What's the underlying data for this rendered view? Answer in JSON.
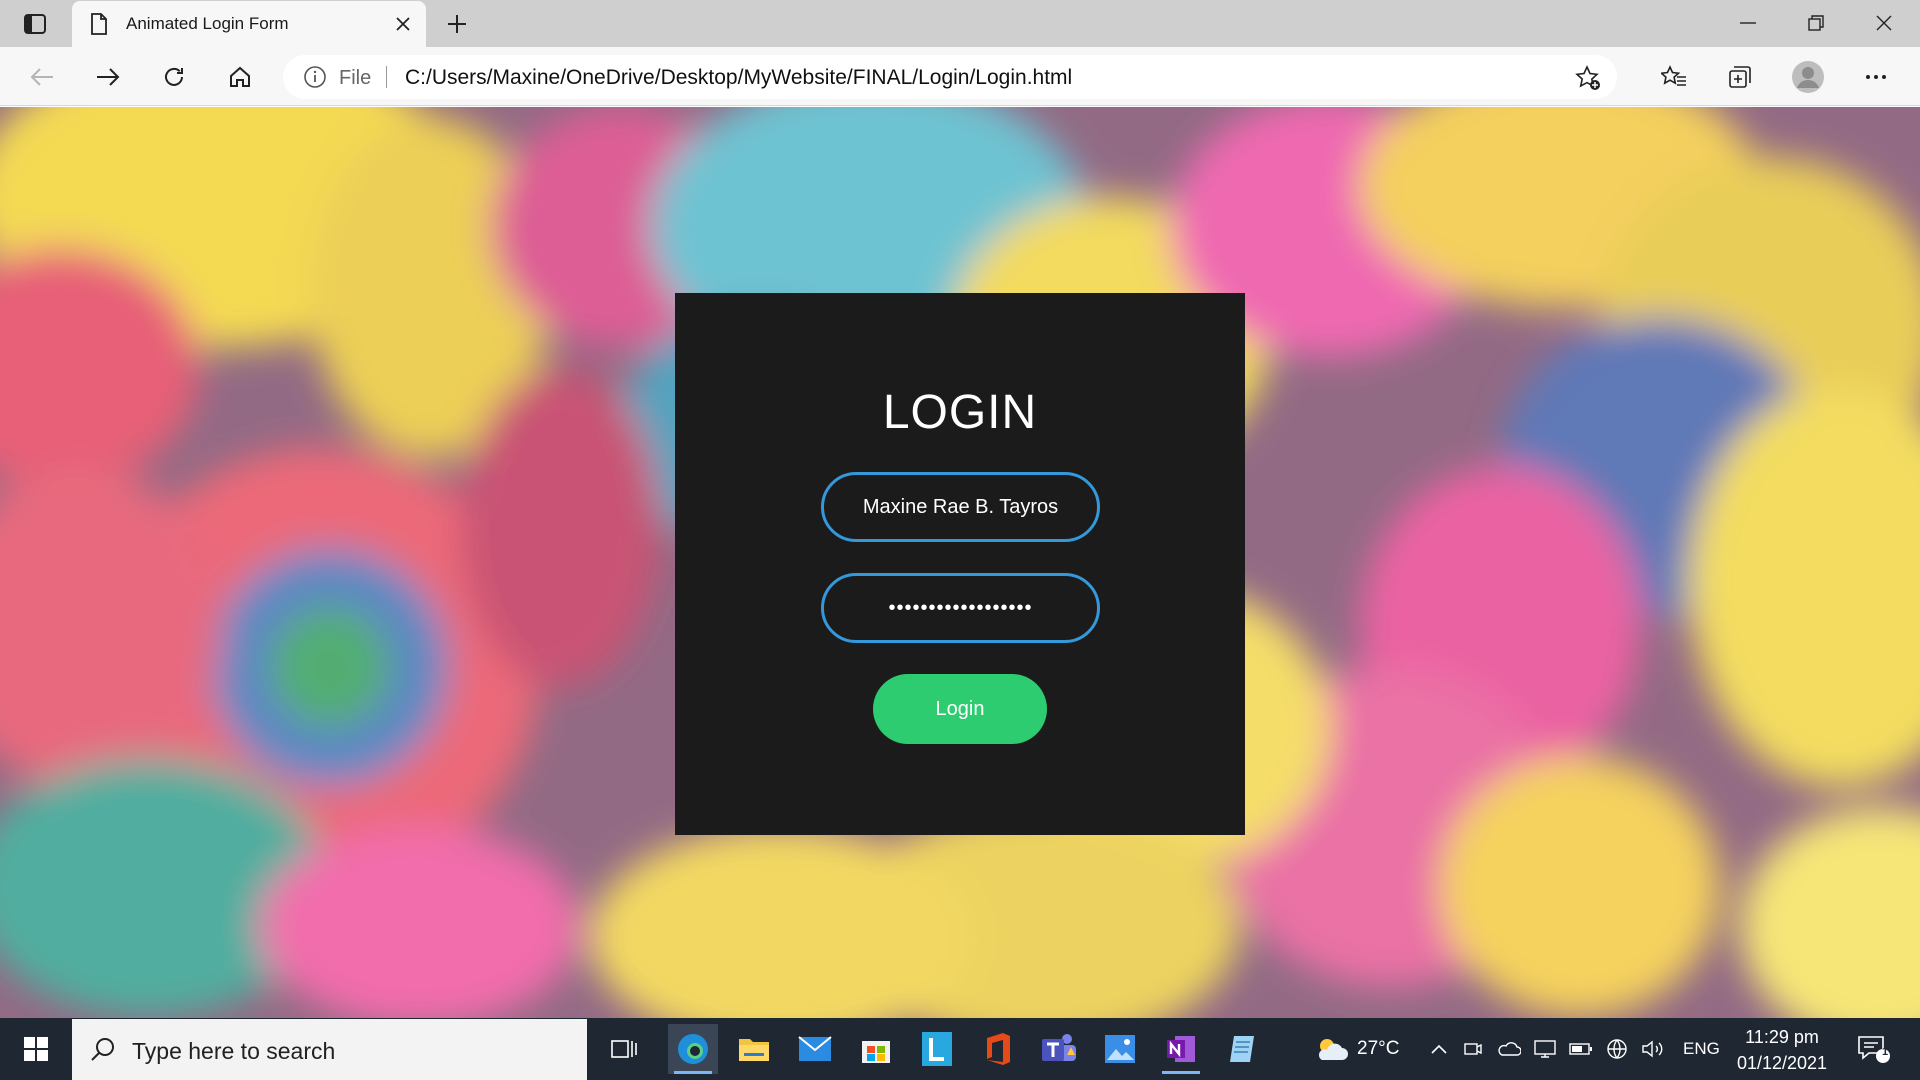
{
  "browser": {
    "tab_title": "Animated Login Form",
    "address": {
      "scheme": "File",
      "url": "C:/Users/Maxine/OneDrive/Desktop/MyWebsite/FINAL/Login/Login.html"
    }
  },
  "page": {
    "login": {
      "title": "LOGIN",
      "username_value": "Maxine Rae B. Tayros",
      "password_masked": "••••••••••••••••••",
      "button_label": "Login"
    },
    "colors": {
      "box_bg": "#1b1b1b",
      "input_border": "#3498db",
      "button_bg": "#2ecc71"
    }
  },
  "taskbar": {
    "search_placeholder": "Type here to search",
    "pinned_apps": [
      "task-view",
      "edge",
      "file-explorer",
      "mail",
      "microsoft-store",
      "lucidchart",
      "office",
      "teams",
      "photos",
      "onenote",
      "notepad"
    ],
    "weather": {
      "temp": "27°C",
      "icon": "partly-cloudy-icon"
    },
    "language": "ENG",
    "time": "11:29 pm",
    "date": "01/12/2021",
    "notification_count": "1"
  }
}
